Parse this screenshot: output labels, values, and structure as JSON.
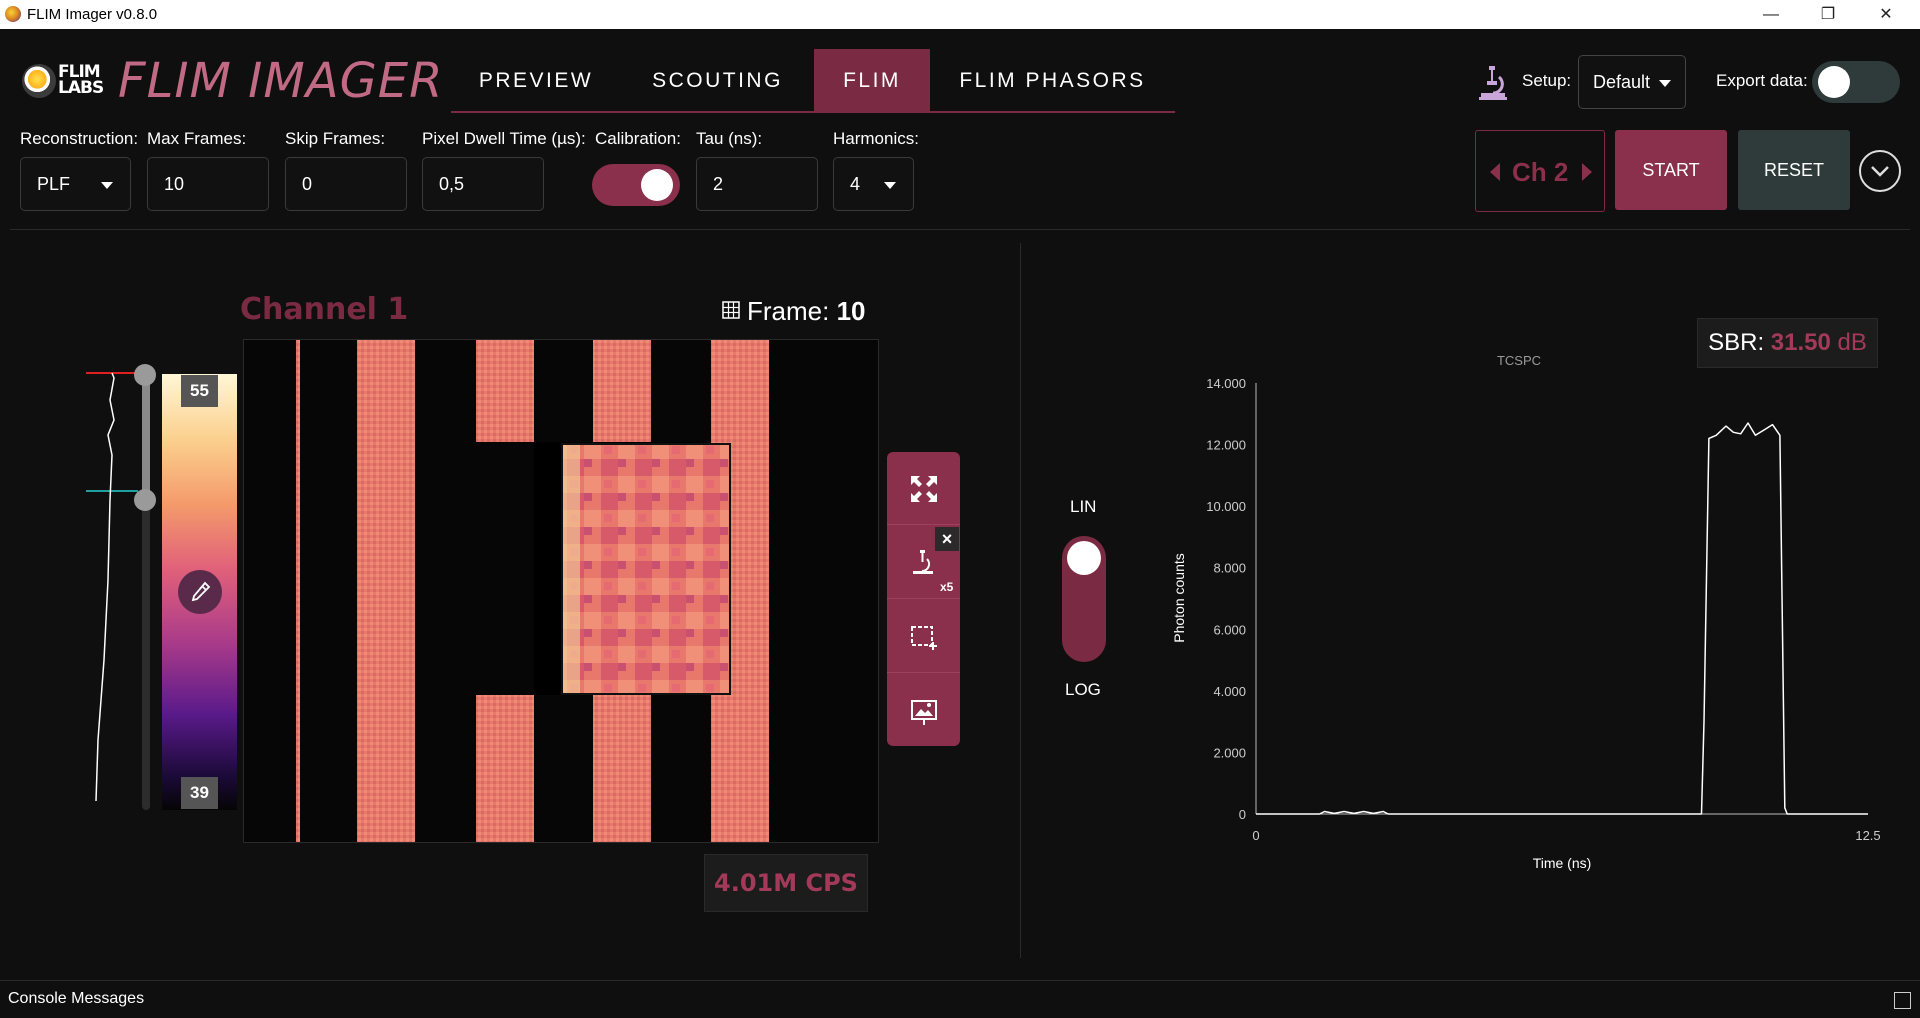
{
  "window": {
    "title": "FLIM Imager v0.8.0",
    "minimize": "—",
    "maximize": "❐",
    "close": "✕"
  },
  "header": {
    "logo_small_line1": "FLIM",
    "logo_small_line2": "LABS",
    "logo_title": "FLIM IMAGER",
    "tabs": [
      {
        "label": "PREVIEW"
      },
      {
        "label": "SCOUTING"
      },
      {
        "label": "FLIM",
        "active": true
      },
      {
        "label": "FLIM PHASORS"
      }
    ],
    "setup_label": "Setup:",
    "setup_value": "Default",
    "export_label": "Export data:",
    "export_enabled": false
  },
  "params": {
    "reconstruction": {
      "label": "Reconstruction:",
      "value": "PLF"
    },
    "max_frames": {
      "label": "Max Frames:",
      "value": "10"
    },
    "skip_frames": {
      "label": "Skip Frames:",
      "value": "0"
    },
    "pixel_dwell": {
      "label": "Pixel Dwell Time (µs):",
      "value": "0,5"
    },
    "calibration": {
      "label": "Calibration:",
      "enabled": true
    },
    "tau": {
      "label": "Tau (ns):",
      "value": "2"
    },
    "harmonics": {
      "label": "Harmonics:",
      "value": "4"
    }
  },
  "controls": {
    "channel": "Ch 2",
    "start": "START",
    "reset": "RESET"
  },
  "image_panel": {
    "channel_title": "Channel 1",
    "frame_label": "Frame:",
    "frame_value": "10",
    "colorbar_max": "55",
    "colorbar_min": "39",
    "cps": "4.01M CPS",
    "zoom_badge": "x5",
    "colors": {
      "stripe": "#e8786e",
      "accent": "#8a2f4c"
    }
  },
  "scale_toggle": {
    "lin": "LIN",
    "log": "LOG",
    "mode": "LIN"
  },
  "sbr": {
    "label": "SBR:",
    "value": "31.50",
    "unit": "dB"
  },
  "chart_data": {
    "type": "line",
    "title": "TCSPC",
    "xlabel": "Time (ns)",
    "ylabel": "Photon counts",
    "xlim": [
      0,
      12.5
    ],
    "ylim": [
      0,
      14000
    ],
    "x_ticks": [
      "0",
      "12.5"
    ],
    "y_ticks": [
      "0",
      "2.000",
      "4.000",
      "6.000",
      "8.000",
      "10.000",
      "12.000",
      "14.000"
    ],
    "grid": false,
    "series": [
      {
        "x": [
          0,
          1.3,
          1.4,
          1.6,
          1.8,
          2.0,
          2.2,
          2.4,
          2.6,
          2.7,
          9.1,
          9.15,
          9.25,
          9.4,
          9.6,
          9.75,
          9.9,
          10.05,
          10.2,
          10.4,
          10.55,
          10.7,
          10.8,
          10.85,
          12.5
        ],
        "y": [
          0,
          0,
          80,
          20,
          80,
          20,
          80,
          20,
          80,
          0,
          0,
          3000,
          12200,
          12300,
          12600,
          12400,
          12350,
          12700,
          12300,
          12500,
          12650,
          12300,
          200,
          0,
          0
        ]
      }
    ]
  },
  "console": {
    "label": "Console Messages"
  }
}
